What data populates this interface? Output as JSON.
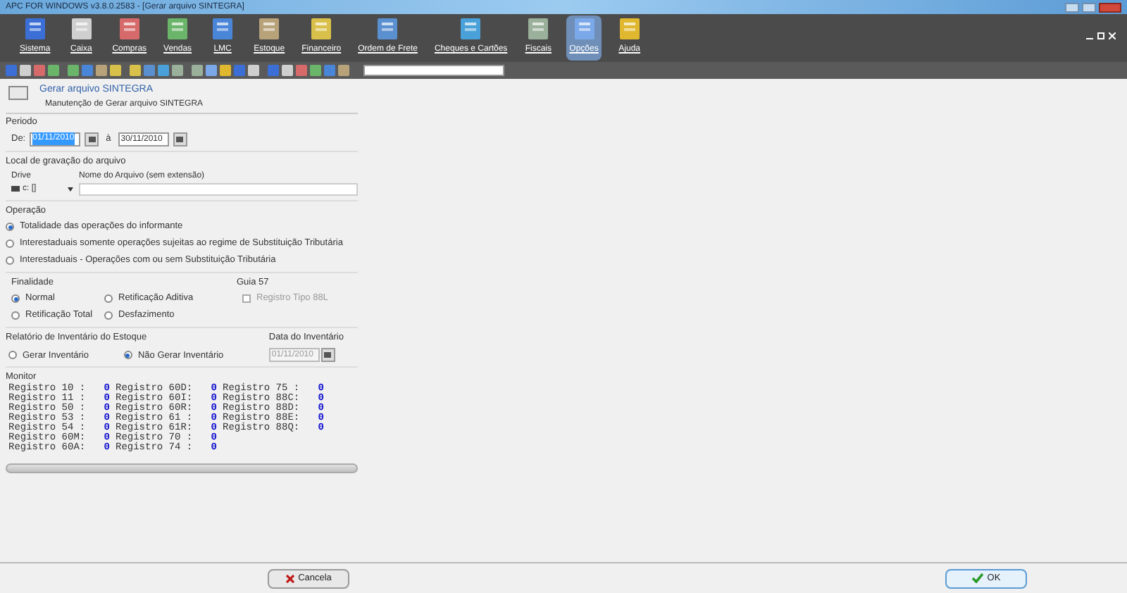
{
  "window": {
    "title": "APC FOR WINDOWS v3.8.0.2583 - [Gerar arquivo SINTEGRA]"
  },
  "menu": [
    {
      "label": "Sistema",
      "selected": false
    },
    {
      "label": "Caixa",
      "selected": false
    },
    {
      "label": "Compras",
      "selected": false
    },
    {
      "label": "Vendas",
      "selected": false
    },
    {
      "label": "LMC",
      "selected": false
    },
    {
      "label": "Estoque",
      "selected": false
    },
    {
      "label": "Financeiro",
      "selected": false
    },
    {
      "label": "Ordem de Frete",
      "selected": false
    },
    {
      "label": "Cheques e Cartões",
      "selected": false
    },
    {
      "label": "Fiscais",
      "selected": false
    },
    {
      "label": "Opções",
      "selected": true
    },
    {
      "label": "Ajuda",
      "selected": false
    }
  ],
  "form": {
    "title": "Gerar arquivo SINTEGRA",
    "subtitle": "Manutenção de Gerar arquivo SINTEGRA"
  },
  "periodo": {
    "label": "Periodo",
    "from_label": "De:",
    "from": "01/11/2010",
    "from_selected": true,
    "to_label": "à",
    "to": "30/11/2010"
  },
  "local": {
    "label": "Local de gravação do arquivo",
    "drive_label": "Drive",
    "drive": "c: []",
    "file_label": "Nome do Arquivo (sem extensão)"
  },
  "operacao": {
    "label": "Operação",
    "options": [
      {
        "label": "Totalidade das operações do informante",
        "selected": true
      },
      {
        "label": "Interestaduais somente operações sujeitas ao regime de Substituição Tributária",
        "selected": false
      },
      {
        "label": "Interestaduais - Operações com ou sem Substituição Tributária",
        "selected": false
      }
    ]
  },
  "finalidade": {
    "label": "Finalidade",
    "options": [
      {
        "label": "Normal",
        "selected": true
      },
      {
        "label": "Retificação Total",
        "selected": false
      },
      {
        "label": "Retificação Aditiva",
        "selected": false
      },
      {
        "label": "Desfazimento",
        "selected": false
      }
    ]
  },
  "guia": {
    "label": "Guia 57",
    "checkbox": {
      "label": "Registro Tipo 88L",
      "checked": false,
      "disabled": true
    }
  },
  "inventario": {
    "label": "Relatório de Inventário do Estoque",
    "options": [
      {
        "label": "Gerar Inventário",
        "selected": false
      },
      {
        "label": "Não Gerar Inventário",
        "selected": true
      }
    ],
    "date_label": "Data do Inventário",
    "date": "01/11/2010",
    "date_disabled": true
  },
  "monitor": {
    "label": "Monitor",
    "columns": [
      [
        {
          "name": "Registro 10 :",
          "value": "0"
        },
        {
          "name": "Registro 11 :",
          "value": "0"
        },
        {
          "name": "Registro 50 :",
          "value": "0"
        },
        {
          "name": "Registro 53 :",
          "value": "0"
        },
        {
          "name": "Registro 54 :",
          "value": "0"
        },
        {
          "name": "Registro 60M:",
          "value": "0"
        },
        {
          "name": "Registro 60A:",
          "value": "0"
        }
      ],
      [
        {
          "name": "Registro 60D:",
          "value": "0"
        },
        {
          "name": "Registro 60I:",
          "value": "0"
        },
        {
          "name": "Registro 60R:",
          "value": "0"
        },
        {
          "name": "Registro 61 :",
          "value": "0"
        },
        {
          "name": "Registro 61R:",
          "value": "0"
        },
        {
          "name": "Registro 70 :",
          "value": "0"
        },
        {
          "name": "Registro 74 :",
          "value": "0"
        }
      ],
      [
        {
          "name": "Registro 75 :",
          "value": "0"
        },
        {
          "name": "Registro 88C:",
          "value": "0"
        },
        {
          "name": "Registro 88D:",
          "value": "0"
        },
        {
          "name": "Registro 88E:",
          "value": "0"
        },
        {
          "name": "Registro 88Q:",
          "value": "0"
        }
      ]
    ]
  },
  "progress": {
    "level": 0
  },
  "buttons": [
    {
      "label": "Cancela",
      "kind": "cancel"
    },
    {
      "label": "OK",
      "kind": "ok"
    }
  ]
}
